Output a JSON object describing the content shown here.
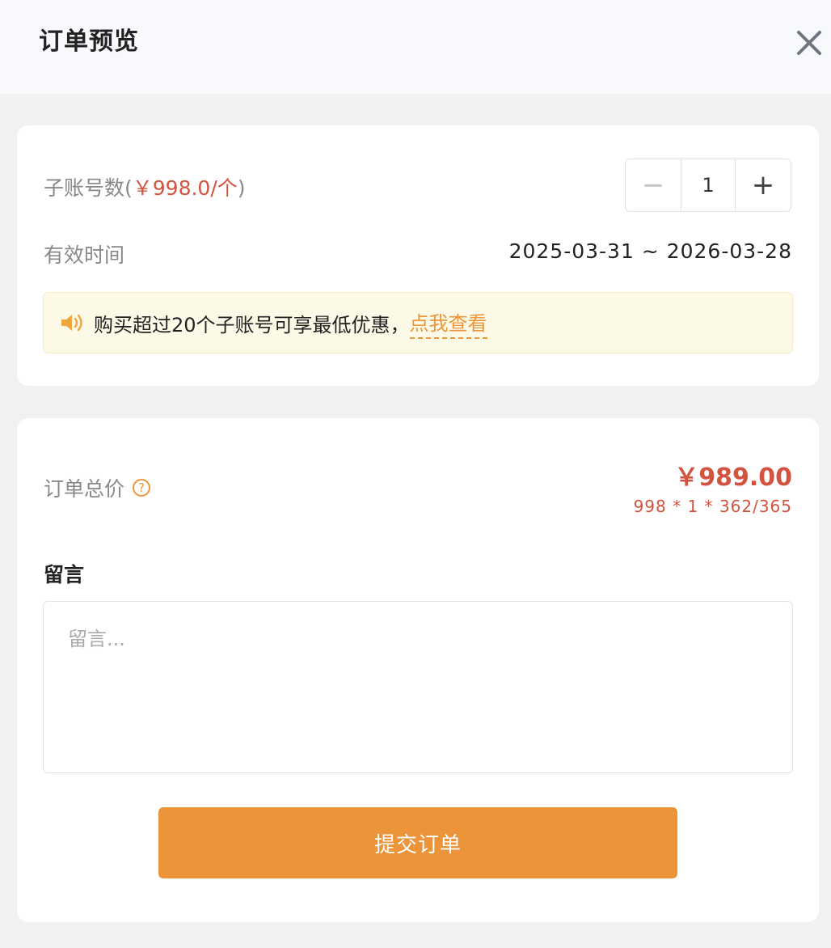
{
  "header": {
    "title": "订单预览"
  },
  "subaccounts": {
    "label": "子账号数(",
    "price_hint": "￥998.0/个",
    "label_suffix": ")",
    "quantity": "1",
    "minus_symbol": "−",
    "plus_symbol": "+"
  },
  "validity": {
    "label": "有效时间",
    "value": "2025-03-31 ~ 2026-03-28"
  },
  "notice": {
    "text": "购买超过20个子账号可享最低优惠，",
    "link": "点我查看",
    "icon": "speaker-icon"
  },
  "order": {
    "total_label": "订单总价",
    "help_icon_label": "?",
    "total_price": "￥989.00",
    "formula": "998 * 1 * 362/365"
  },
  "remark": {
    "title": "留言",
    "placeholder": "留言..."
  },
  "submit_label": "提交订单",
  "colors": {
    "accent": "#ec943a",
    "price": "#d2533f",
    "notice_bg": "#fdf9e7"
  }
}
